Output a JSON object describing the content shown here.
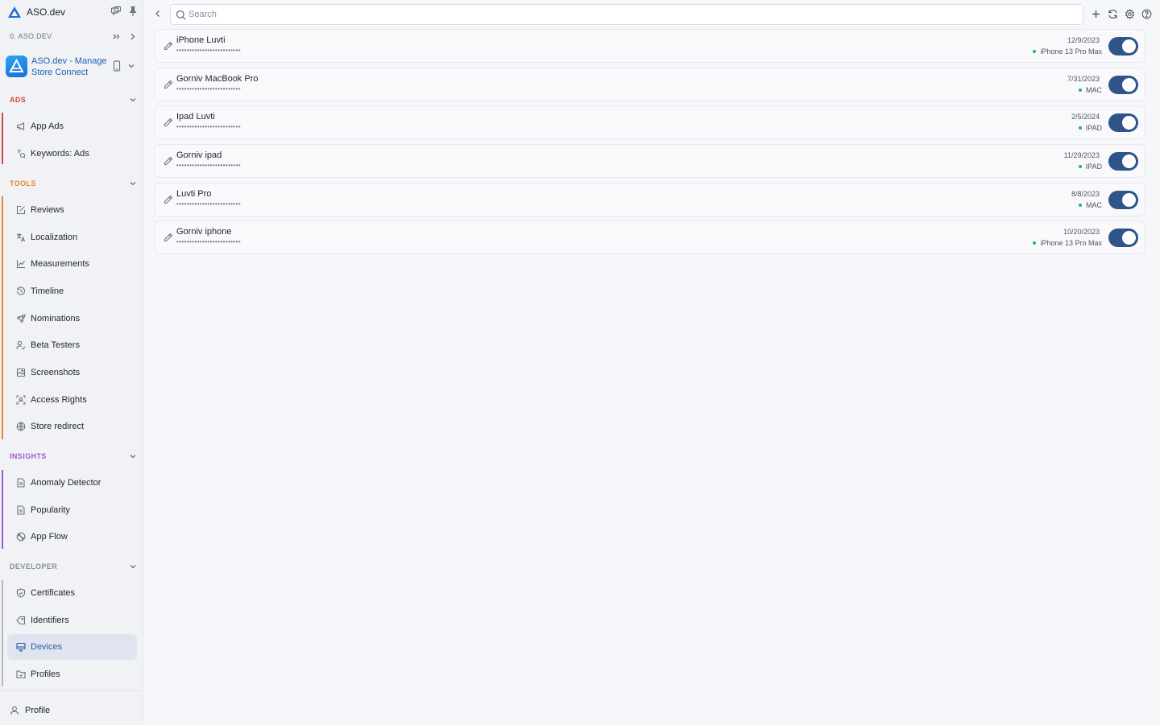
{
  "app": {
    "name": "ASO.dev"
  },
  "org": {
    "name": "0. ASO.DEV"
  },
  "current_app": {
    "title": "ASO.dev - Manage Store Connect"
  },
  "sections": {
    "ads": {
      "title": "ADS",
      "color": "#d64545",
      "items": [
        {
          "label": "App Ads",
          "icon": "megaphone-icon"
        },
        {
          "label": "Keywords: Ads",
          "icon": "keywords-icon"
        }
      ]
    },
    "tools": {
      "title": "TOOLS",
      "color": "#e8842c",
      "items": [
        {
          "label": "Reviews",
          "icon": "reviews-icon"
        },
        {
          "label": "Localization",
          "icon": "localization-icon"
        },
        {
          "label": "Measurements",
          "icon": "chart-icon"
        },
        {
          "label": "Timeline",
          "icon": "history-icon"
        },
        {
          "label": "Nominations",
          "icon": "rocket-icon"
        },
        {
          "label": "Beta Testers",
          "icon": "user-check-icon"
        },
        {
          "label": "Screenshots",
          "icon": "image-icon"
        },
        {
          "label": "Access Rights",
          "icon": "access-icon"
        },
        {
          "label": "Store redirect",
          "icon": "globe-icon"
        }
      ]
    },
    "insights": {
      "title": "INSIGHTS",
      "color": "#9b59d6",
      "items": [
        {
          "label": "Anomaly Detector",
          "icon": "document-icon"
        },
        {
          "label": "Popularity",
          "icon": "document-icon"
        },
        {
          "label": "App Flow",
          "icon": "flow-icon"
        }
      ]
    },
    "developer": {
      "title": "DEVELOPER",
      "color": "#8a8f99",
      "items": [
        {
          "label": "Certificates",
          "icon": "shield-icon"
        },
        {
          "label": "Identifiers",
          "icon": "tag-icon"
        },
        {
          "label": "Devices",
          "icon": "monitor-icon",
          "active": true
        },
        {
          "label": "Profiles",
          "icon": "folder-icon"
        }
      ]
    }
  },
  "footer": {
    "profile_label": "Profile"
  },
  "search": {
    "placeholder": "Search",
    "value": ""
  },
  "devices": [
    {
      "name": "iPhone Luvti",
      "udid": "•••••••••••••••••••••••••",
      "date": "12/9/2023",
      "platform": "iPhone 13 Pro Max",
      "enabled": true
    },
    {
      "name": "Gorniv MacBook Pro",
      "udid": "•••••••••••••••••••••••••",
      "date": "7/31/2023",
      "platform": "MAC",
      "enabled": true
    },
    {
      "name": "Ipad Luvti",
      "udid": "•••••••••••••••••••••••••",
      "date": "2/5/2024",
      "platform": "IPAD",
      "enabled": true
    },
    {
      "name": "Gorniv ipad",
      "udid": "•••••••••••••••••••••••••",
      "date": "11/29/2023",
      "platform": "IPAD",
      "enabled": true
    },
    {
      "name": "Luvti Pro",
      "udid": "•••••••••••••••••••••••••",
      "date": "8/8/2023",
      "platform": "MAC",
      "enabled": true
    },
    {
      "name": "Gorniv iphone",
      "udid": "•••••••••••••••••••••••••",
      "date": "10/20/2023",
      "platform": "iPhone 13 Pro Max",
      "enabled": true
    }
  ],
  "colors": {
    "accent": "#2f5489",
    "status_green": "#22b07d",
    "active_nav_bg": "#dfe4ee"
  }
}
